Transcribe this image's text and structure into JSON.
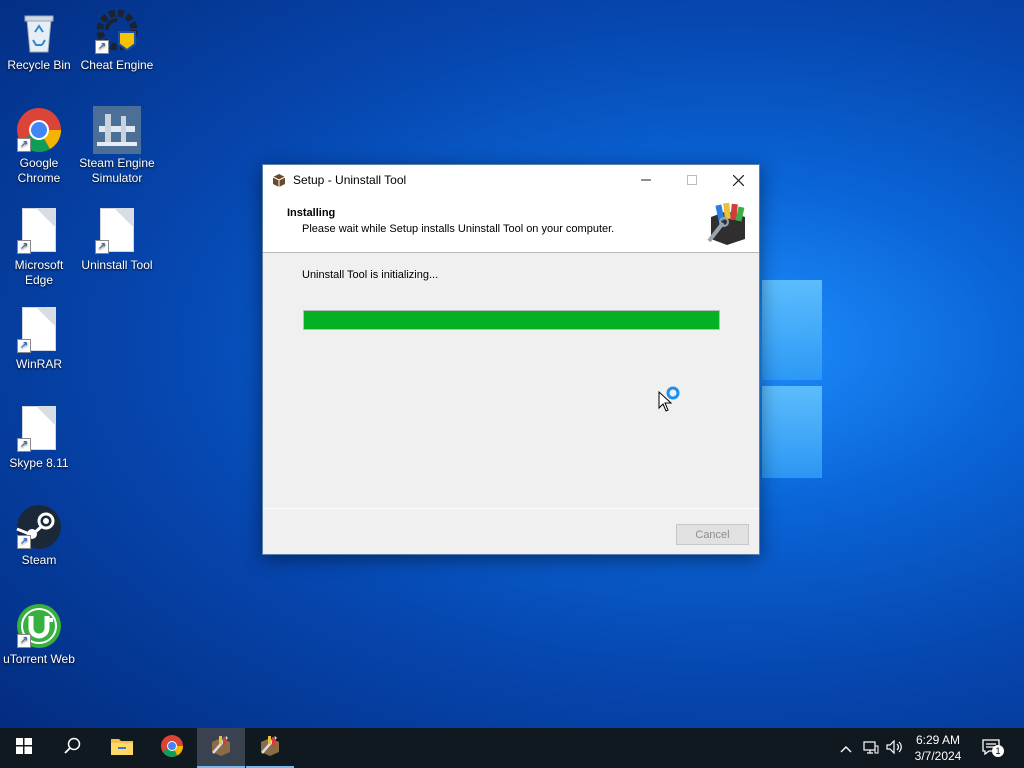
{
  "desktop": {
    "icons": [
      {
        "label": "Recycle Bin",
        "icon": "recycle-bin-icon"
      },
      {
        "label": "Cheat Engine",
        "icon": "cheat-engine-icon"
      },
      {
        "label": "Google Chrome",
        "icon": "chrome-icon"
      },
      {
        "label": "Steam Engine Simulator",
        "icon": "steam-engine-simulator-icon"
      },
      {
        "label": "Microsoft Edge",
        "icon": "document-icon"
      },
      {
        "label": "Uninstall Tool",
        "icon": "document-icon"
      },
      {
        "label": "WinRAR",
        "icon": "document-icon"
      },
      {
        "label": "Skype 8.11",
        "icon": "document-icon"
      },
      {
        "label": "Steam",
        "icon": "steam-icon"
      },
      {
        "label": "uTorrent Web",
        "icon": "utorrent-icon"
      }
    ]
  },
  "dialog": {
    "title": "Setup - Uninstall Tool",
    "header_title": "Installing",
    "header_subtitle": "Please wait while Setup installs Uninstall Tool on your computer.",
    "status": "Uninstall Tool is initializing...",
    "progress": 1.0,
    "cancel_label": "Cancel"
  },
  "taskbar": {
    "time": "6:29 AM",
    "date": "3/7/2024",
    "notification_count": "1"
  },
  "colors": {
    "progress_fill": "#06b025",
    "taskbar": "#101820",
    "accent": "#76b9ed"
  }
}
